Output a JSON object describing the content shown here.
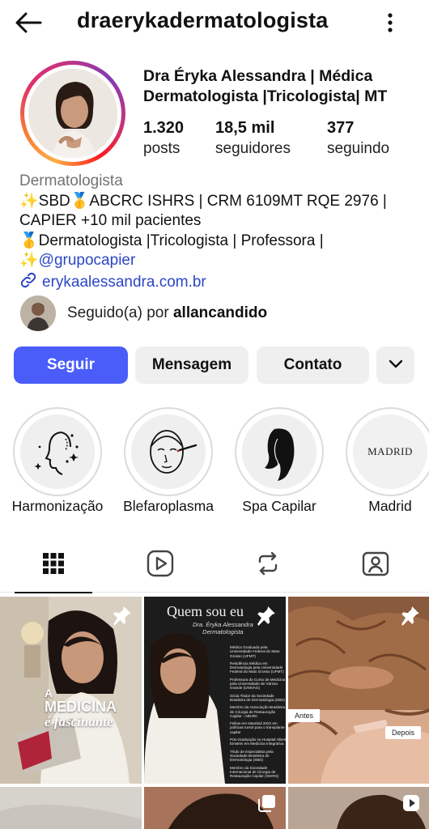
{
  "header": {
    "username": "draerykadermatologista"
  },
  "profile": {
    "full_name_line1": "Dra Éryka Alessandra | Médica",
    "full_name_line2": "Dermatologista |Tricologista| MT",
    "stats": [
      {
        "value": "1.320",
        "label": "posts"
      },
      {
        "value": "18,5 mil",
        "label": "seguidores"
      },
      {
        "value": "377",
        "label": "seguindo"
      }
    ]
  },
  "bio": {
    "category": "Dermatologista",
    "line1": "✨SBD🥇ABCRC ISHRS | CRM 6109MT RQE 2976 |",
    "line2": "CAPIER +10 mil pacientes",
    "line3": "🥇Dermatologista |Tricologista | Professora |",
    "line4_prefix": "✨",
    "line4_link": "@grupocapier",
    "website": "erykaalessandra.com.br"
  },
  "followed_by": {
    "prefix": "Seguido(a) por ",
    "name": "allancandido"
  },
  "actions": {
    "follow": "Seguir",
    "message": "Mensagem",
    "contact": "Contato"
  },
  "highlights": [
    {
      "label": "Harmonização"
    },
    {
      "label": "Blefaroplasma"
    },
    {
      "label": "Spa Capilar"
    },
    {
      "label": "Madrid",
      "cover_text": "MADRID"
    }
  ],
  "posts": {
    "post1": {
      "overlay_line1": "A",
      "overlay_line2": "MEDICINA",
      "overlay_line3": "é fascinante"
    },
    "post2": {
      "title": "Quem sou eu",
      "subtitle_line1": "Dra. Éryka Alessandra",
      "subtitle_line2": "Dermatologista",
      "items": [
        "Médica Graduada pela Universidade Federal do Mato Grosso (UFMT)",
        "Residência Médica em Dermatologia pela Universidade Federal do Mato Grosso (UFMT)",
        "Professora do Curso de Medicina pela Universidade de Várzea Grande (UNIVAG)",
        "Sócia Titular da Sociedade Brasileira de Dermatologia (SBD)",
        "Membro da Associação Brasileira de Cirurgia de Restauração Capilar - ABCRC",
        "Fellow em Istambul 2022 em políticas tursol para o transplante capilar",
        "Pós-Graduação no Hospital Albert Einstein em Medicina Integrativa",
        "Título de Especialista pela Sociedade Brasileira de Dermatologia (SBD)",
        "Membro da Sociedade Internacional de Cirurgia de Restauração Capilar (ISHRS)"
      ]
    },
    "post3": {
      "before_label": "Antes",
      "after_label": "Depois"
    }
  },
  "colors": {
    "primary_button": "#4a5df9",
    "link": "#2b46c4",
    "muted": "#737373"
  }
}
